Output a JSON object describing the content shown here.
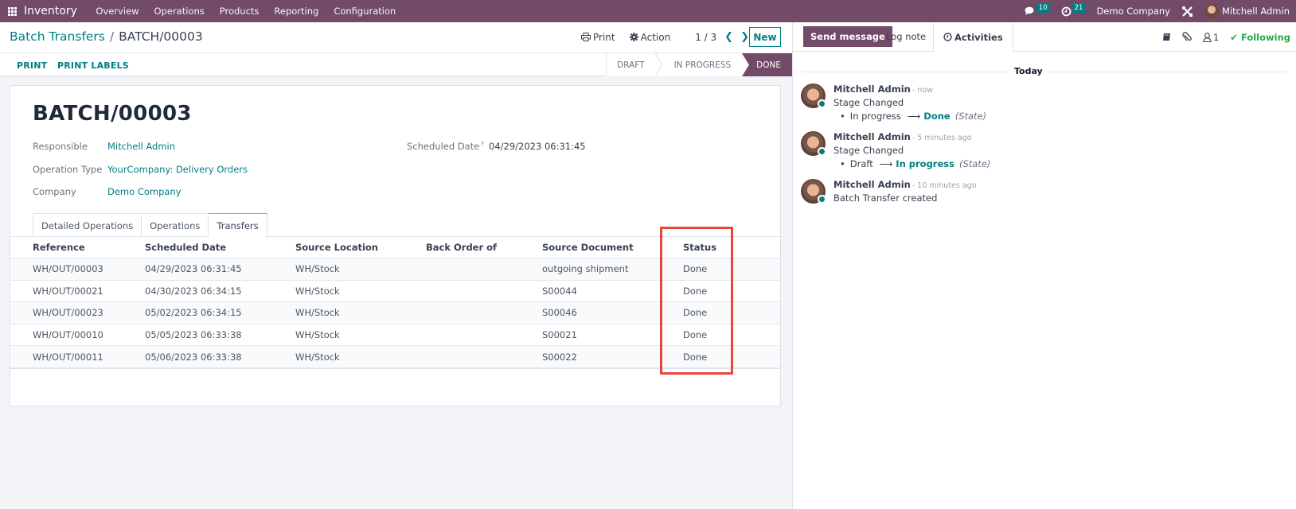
{
  "navbar": {
    "app_name": "Inventory",
    "menu": [
      "Overview",
      "Operations",
      "Products",
      "Reporting",
      "Configuration"
    ],
    "messages_count": "10",
    "activities_count": "21",
    "company": "Demo Company",
    "user": "Mitchell Admin"
  },
  "control": {
    "breadcrumb_parent": "Batch Transfers",
    "breadcrumb_separator": "/",
    "breadcrumb_current": "BATCH/00003",
    "print_label": "Print",
    "action_label": "Action",
    "pager_value": "1 / 3",
    "new_label": "New",
    "header_buttons": [
      "PRINT",
      "PRINT LABELS"
    ],
    "stages": [
      "DRAFT",
      "IN PROGRESS",
      "DONE"
    ],
    "current_stage": "DONE"
  },
  "record": {
    "title": "BATCH/00003",
    "fields": {
      "responsible_label": "Responsible",
      "responsible_value": "Mitchell Admin",
      "operation_type_label": "Operation Type",
      "operation_type_value": "YourCompany: Delivery Orders",
      "company_label": "Company",
      "company_value": "Demo Company",
      "scheduled_date_label": "Scheduled Date",
      "scheduled_date_tooltip": "?",
      "scheduled_date_value": "04/29/2023 06:31:45"
    },
    "tabs": [
      "Detailed Operations",
      "Operations",
      "Transfers"
    ],
    "active_tab": "Transfers",
    "table": {
      "columns": [
        "Reference",
        "Scheduled Date",
        "Source Location",
        "Back Order of",
        "Source Document",
        "Status"
      ],
      "rows": [
        {
          "reference": "WH/OUT/00003",
          "scheduled_date": "04/29/2023 06:31:45",
          "source_location": "WH/Stock",
          "back_order_of": "",
          "source_document": "outgoing shipment",
          "status": "Done"
        },
        {
          "reference": "WH/OUT/00021",
          "scheduled_date": "04/30/2023 06:34:15",
          "source_location": "WH/Stock",
          "back_order_of": "",
          "source_document": "S00044",
          "status": "Done"
        },
        {
          "reference": "WH/OUT/00023",
          "scheduled_date": "05/02/2023 06:34:15",
          "source_location": "WH/Stock",
          "back_order_of": "",
          "source_document": "S00046",
          "status": "Done"
        },
        {
          "reference": "WH/OUT/00010",
          "scheduled_date": "05/05/2023 06:33:38",
          "source_location": "WH/Stock",
          "back_order_of": "",
          "source_document": "S00021",
          "status": "Done"
        },
        {
          "reference": "WH/OUT/00011",
          "scheduled_date": "05/06/2023 06:33:38",
          "source_location": "WH/Stock",
          "back_order_of": "",
          "source_document": "S00022",
          "status": "Done"
        }
      ]
    }
  },
  "chatter": {
    "send_message_label": "Send message",
    "log_note_label": "Log note",
    "activities_label": "Activities",
    "followers_count": "1",
    "following_label": "Following",
    "date_separator": "Today",
    "messages": [
      {
        "author": "Mitchell Admin",
        "time": "- now",
        "body": "Stage Changed",
        "old_value": "In progress",
        "new_value": "Done",
        "field": "(State)"
      },
      {
        "author": "Mitchell Admin",
        "time": "- 5 minutes ago",
        "body": "Stage Changed",
        "old_value": "Draft",
        "new_value": "In progress",
        "field": "(State)"
      },
      {
        "author": "Mitchell Admin",
        "time": "- 10 minutes ago",
        "body": "Batch Transfer created"
      }
    ]
  },
  "colors": {
    "brand": "#714B67",
    "accent": "#017E84",
    "following": "#28a745",
    "highlight_box": "#e8453c"
  }
}
